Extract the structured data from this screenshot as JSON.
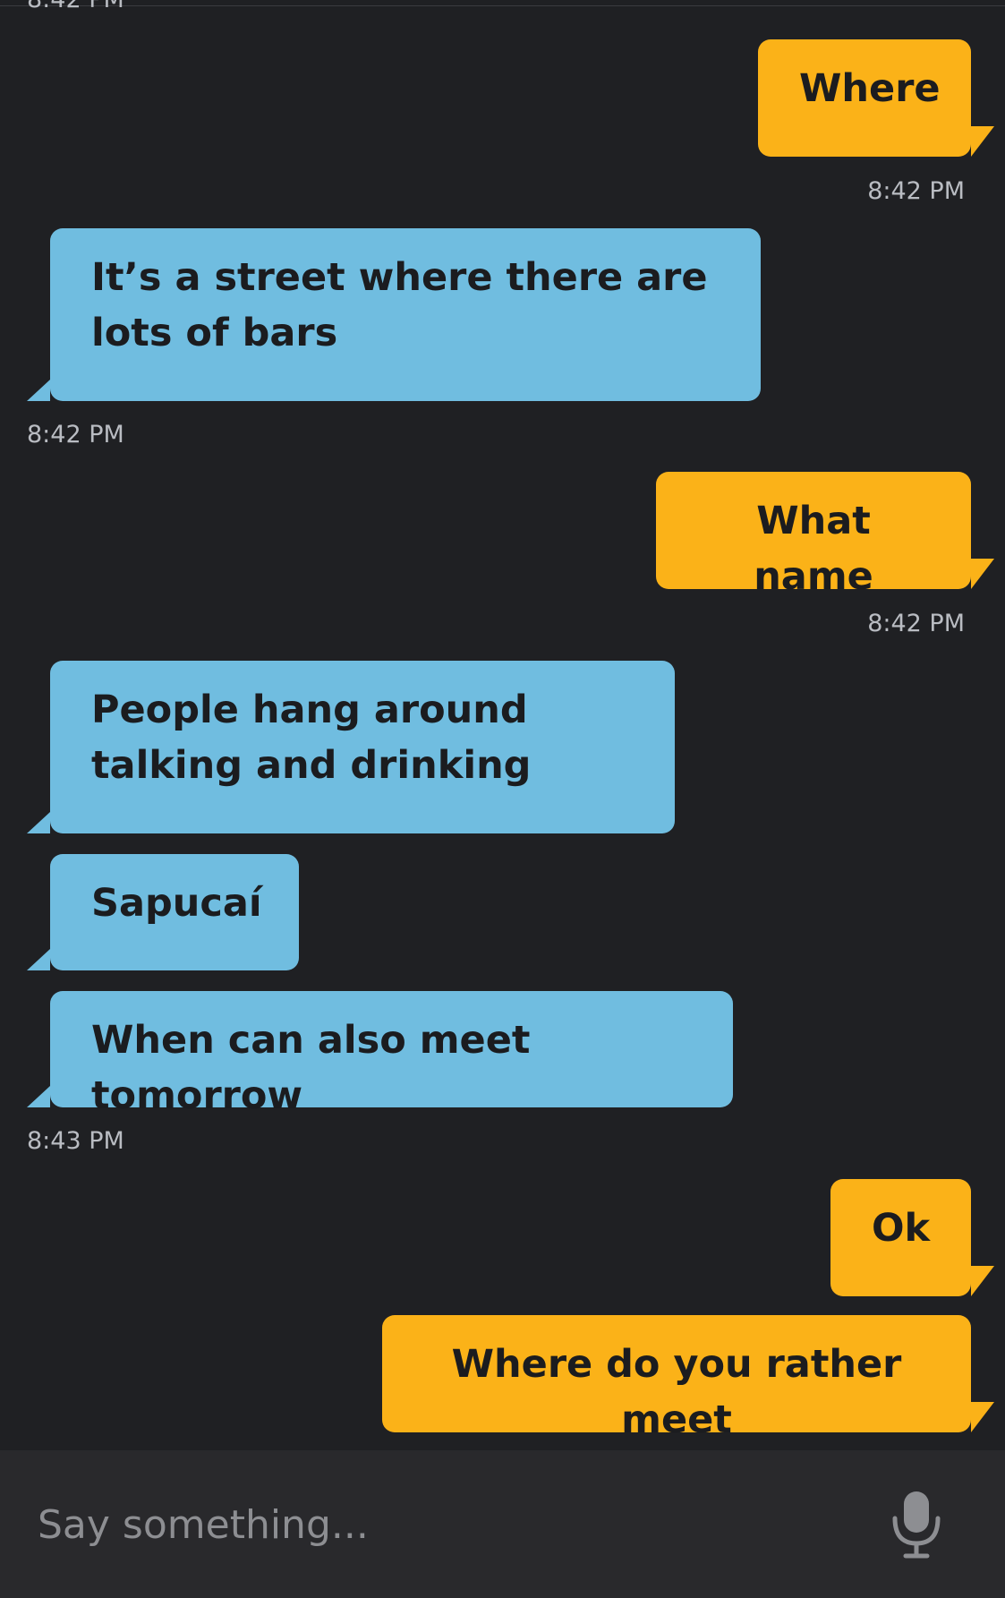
{
  "messages": [
    {
      "side": "sent",
      "text": "Where",
      "time": "8:42 PM"
    },
    {
      "side": "received",
      "text": "It’s a street where there are lots of bars",
      "time": "8:42 PM"
    },
    {
      "side": "sent",
      "text": "What name",
      "time": "8:42 PM"
    },
    {
      "side": "received",
      "text": "People hang around talking and drinking"
    },
    {
      "side": "received",
      "text": "Sapucaí"
    },
    {
      "side": "received",
      "text": "When can also meet tomorrow",
      "time": "8:43 PM"
    },
    {
      "side": "sent",
      "text": "Ok"
    },
    {
      "side": "sent",
      "text": "Where do you rather meet"
    }
  ],
  "composer": {
    "placeholder": "Say something...",
    "mic_icon": "microphone-icon"
  },
  "colors": {
    "background": "#1f2023",
    "sent_bubble": "#fbb218",
    "received_bubble": "#70bde0",
    "composer_bg": "#29292c"
  }
}
